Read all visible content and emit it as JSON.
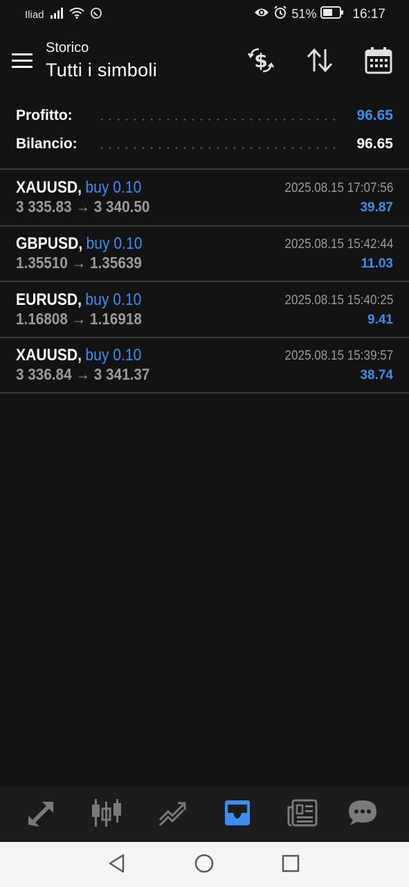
{
  "status_bar": {
    "carrier": "Iliad",
    "battery_percent": "51%",
    "time": "16:17"
  },
  "header": {
    "subtitle": "Storico",
    "title": "Tutti i simboli"
  },
  "summary": {
    "profit_label": "Profitto:",
    "profit_value": "96.65",
    "balance_label": "Bilancio:",
    "balance_value": "96.65"
  },
  "trades": [
    {
      "symbol": "XAUUSD",
      "side": "buy 0.10",
      "prices": "3 335.83 → 3 340.50",
      "time": "2025.08.15 17:07:56",
      "profit": "39.87"
    },
    {
      "symbol": "GBPUSD",
      "side": "buy 0.10",
      "prices": "1.35510 → 1.35639",
      "time": "2025.08.15 15:42:44",
      "profit": "11.03"
    },
    {
      "symbol": "EURUSD",
      "side": "buy 0.10",
      "prices": "1.16808 → 1.16918",
      "time": "2025.08.15 15:40:25",
      "profit": "9.41"
    },
    {
      "symbol": "XAUUSD",
      "side": "buy 0.10",
      "prices": "3 336.84 → 3 341.37",
      "time": "2025.08.15 15:39:57",
      "profit": "38.74"
    }
  ],
  "tabs": [
    {
      "icon": "quotes-icon",
      "active": false
    },
    {
      "icon": "chart-icon",
      "active": false
    },
    {
      "icon": "trade-icon",
      "active": false
    },
    {
      "icon": "history-icon",
      "active": true
    },
    {
      "icon": "news-icon",
      "active": false
    },
    {
      "icon": "chat-icon",
      "active": false
    }
  ],
  "colors": {
    "accent": "#3d8ef0",
    "background": "#131313",
    "muted_text": "#9a9a9a",
    "tab_bar": "#1c1c1c"
  }
}
